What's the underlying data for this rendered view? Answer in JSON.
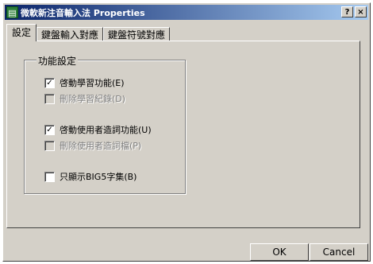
{
  "window": {
    "title": "微軟新注音輸入法 Properties",
    "app_icon_glyph": "▤",
    "help_label": "?",
    "close_label": "×"
  },
  "tabs": [
    {
      "label": "設定",
      "active": true
    },
    {
      "label": "鍵盤輸入對應",
      "active": false
    },
    {
      "label": "鍵盤符號對應",
      "active": false
    }
  ],
  "group": {
    "label": "功能設定",
    "options": [
      {
        "label": "啓動學習功能(E)",
        "checked": true,
        "disabled": false
      },
      {
        "label": "刪除學習紀錄(D)",
        "checked": false,
        "disabled": true
      },
      {
        "label": "啓動使用者造詞功能(U)",
        "checked": true,
        "disabled": false
      },
      {
        "label": "刪除使用者造詞檔(P)",
        "checked": false,
        "disabled": true
      },
      {
        "label": "只顯示BIG5字集(B)",
        "checked": false,
        "disabled": false
      }
    ]
  },
  "buttons": {
    "ok_label": "OK",
    "cancel_label": "Cancel"
  },
  "check_glyph": "✓"
}
